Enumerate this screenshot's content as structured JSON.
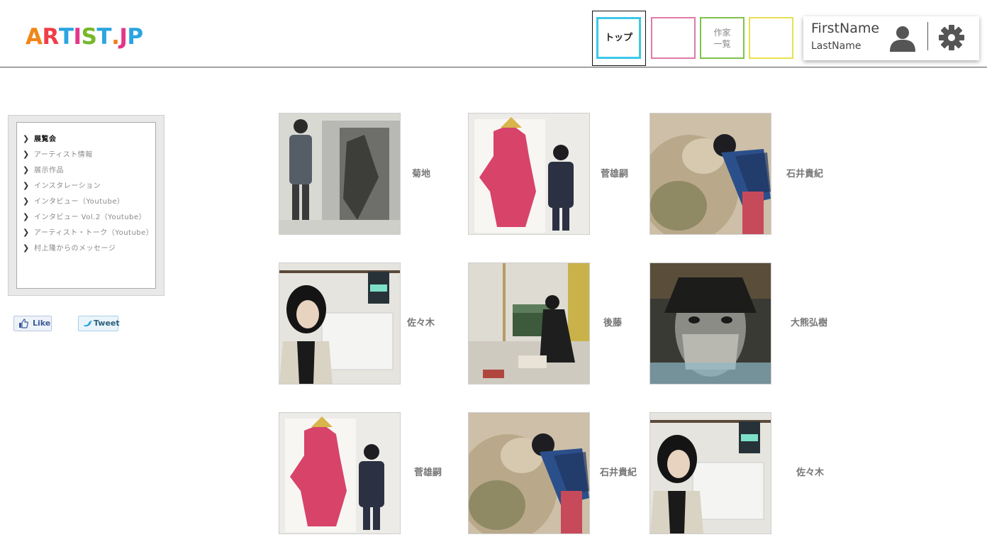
{
  "header": {
    "logo": {
      "letters": [
        "A",
        "R",
        "T",
        "I",
        "S",
        "T",
        ".",
        "J",
        "P"
      ],
      "colors": [
        "#f0861a",
        "#ef3e48",
        "#2aa5e0",
        "#e4368b",
        "#76b82a",
        "#2aa5e0",
        "#ef7d1a",
        "#e4368b",
        "#2aa5e0"
      ]
    },
    "nav": {
      "top_label": "トップ",
      "artists_line1": "作家",
      "artists_line2": "一覧"
    },
    "user": {
      "first_name": "FirstName",
      "last_name": "LastName",
      "user_icon": "person-icon",
      "settings_icon": "gear-icon"
    }
  },
  "sidebar": {
    "items": [
      {
        "label": "展覧会",
        "active": true
      },
      {
        "label": "アーティスト情報",
        "active": false
      },
      {
        "label": "展示作品",
        "active": false
      },
      {
        "label": "インスタレーション",
        "active": false
      },
      {
        "label": "インタビュー（Youtube）",
        "active": false
      },
      {
        "label": "インタビュー Vol.2（Youtube）",
        "active": false
      },
      {
        "label": "アーティスト・トーク（Youtube）",
        "active": false
      },
      {
        "label": "村上隆からのメッセージ",
        "active": false
      }
    ],
    "chevron": "❯"
  },
  "social": {
    "like_label": "Like",
    "tweet_label": "Tweet"
  },
  "gallery": {
    "artists": [
      {
        "name": "菊地"
      },
      {
        "name": "菅雄嗣"
      },
      {
        "name": "石井貴紀"
      },
      {
        "name": "佐々木"
      },
      {
        "name": "後藤"
      },
      {
        "name": "大熊弘樹"
      },
      {
        "name": "菅雄嗣"
      },
      {
        "name": "石井貴紀"
      },
      {
        "name": "佐々木"
      }
    ]
  },
  "colors": {
    "cyan": "#3cc8e8",
    "pink": "#e07aa7",
    "green": "#7fc24a",
    "yellow": "#e8e050"
  }
}
